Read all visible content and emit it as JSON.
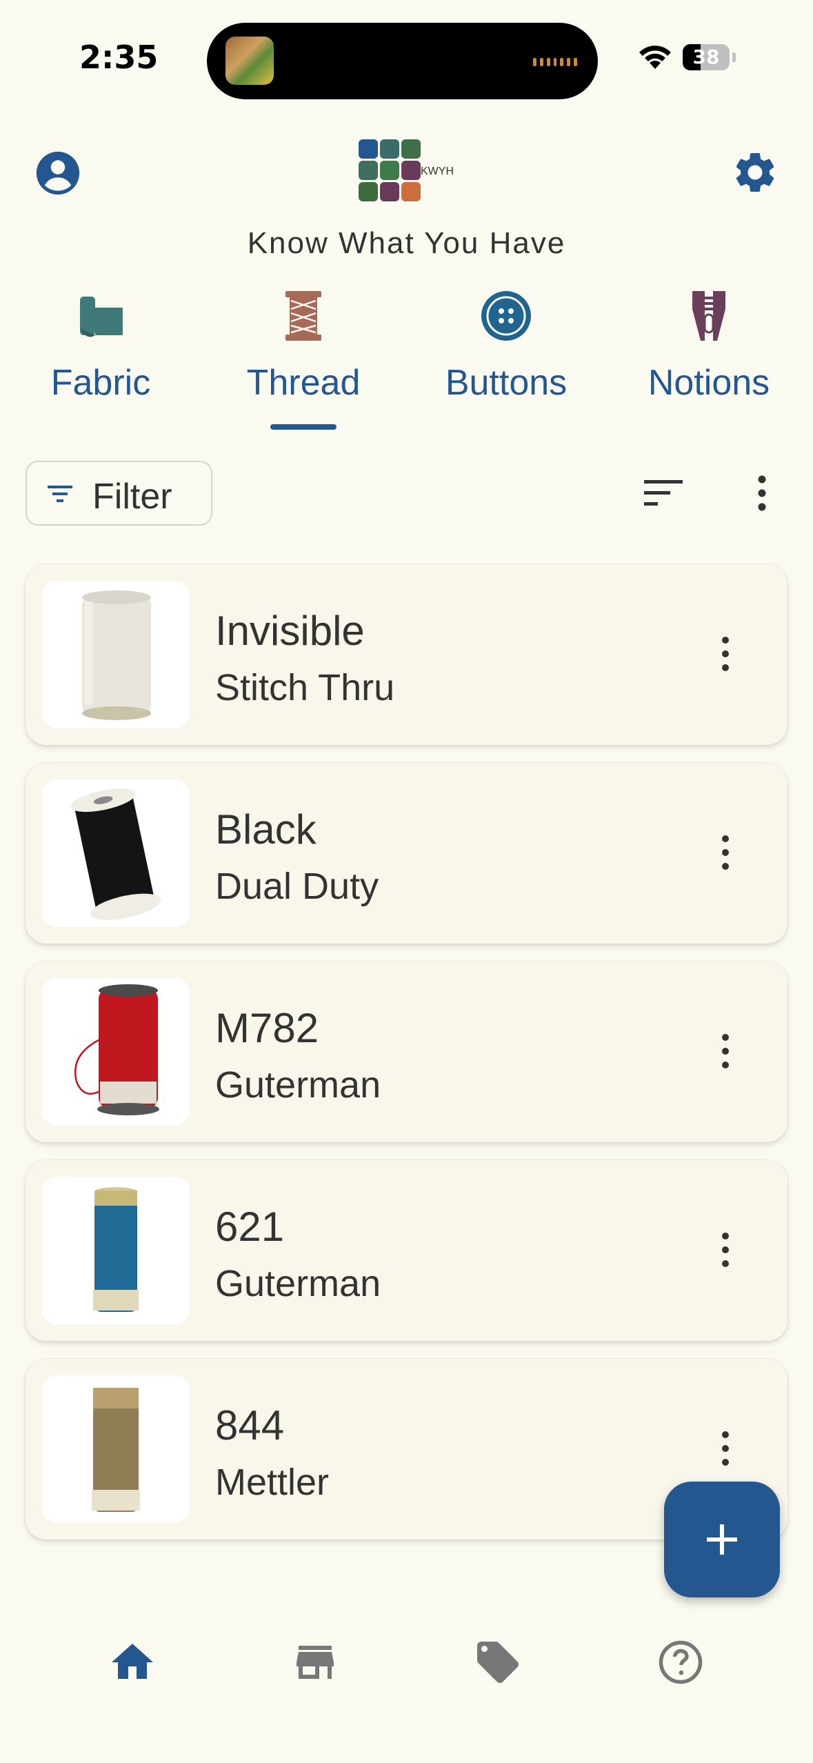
{
  "status_bar": {
    "time": "2:35",
    "battery_level": 38,
    "battery_text": "38"
  },
  "header": {
    "logo_text": "KWYH",
    "app_title": "Know What You Have",
    "profile_icon": "account-circle-icon",
    "settings_icon": "gear-icon"
  },
  "tabs": [
    {
      "label": "Fabric",
      "icon": "fabric-bolt-icon",
      "selected": false
    },
    {
      "label": "Thread",
      "icon": "thread-spool-icon",
      "selected": true
    },
    {
      "label": "Buttons",
      "icon": "button-icon",
      "selected": false
    },
    {
      "label": "Notions",
      "icon": "zipper-icon",
      "selected": false
    }
  ],
  "toolbar": {
    "filter_label": "Filter",
    "sort_icon": "sort-icon",
    "more_icon": "more-vert-icon"
  },
  "items": [
    {
      "title": "Invisible",
      "subtitle": "Stitch Thru",
      "spool_color": "#e8e6dc"
    },
    {
      "title": "Black",
      "subtitle": "Dual Duty",
      "spool_color": "#141414"
    },
    {
      "title": "M782",
      "subtitle": "Guterman",
      "spool_color": "#c0161d"
    },
    {
      "title": "621",
      "subtitle": "Guterman",
      "spool_color": "#1f6b96"
    },
    {
      "title": "844",
      "subtitle": "Mettler",
      "spool_color": "#8f7d55"
    }
  ],
  "fab": {
    "icon": "plus-icon"
  },
  "bottom_nav": [
    {
      "icon": "home-icon",
      "selected": true
    },
    {
      "icon": "store-icon",
      "selected": false
    },
    {
      "icon": "tag-icon",
      "selected": false
    },
    {
      "icon": "help-icon",
      "selected": false
    }
  ],
  "colors": {
    "primary": "#24578f",
    "background": "#fafaf0",
    "card": "#f9f7eb",
    "text": "#333333"
  }
}
